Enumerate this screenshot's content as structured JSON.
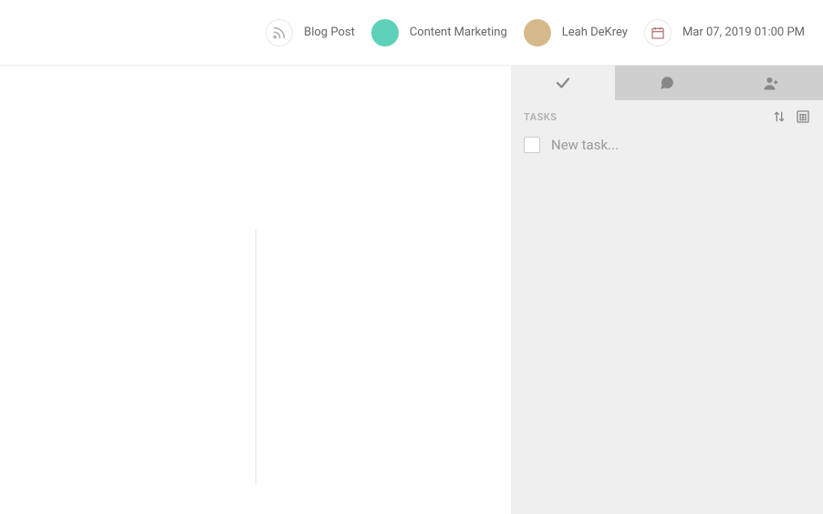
{
  "header": {
    "postType": {
      "label": "Blog Post",
      "icon": "rss-icon"
    },
    "category": {
      "label": "Content Marketing",
      "color": "#5ed1b9"
    },
    "author": {
      "label": "Leah DeKrey"
    },
    "schedule": {
      "label": "Mar 07, 2019 01:00 PM",
      "icon": "calendar-icon"
    }
  },
  "sidePanel": {
    "title": "TASKS",
    "newTaskPlaceholder": "New task...",
    "tabs": {
      "tasks": "tasks",
      "comments": "comments",
      "team": "team"
    }
  },
  "colors": {
    "accent": "#5ed1b9",
    "panelBg": "#efefef",
    "tabInactive": "#cfcfcf",
    "muted": "#999999",
    "iconGray": "#888888"
  }
}
